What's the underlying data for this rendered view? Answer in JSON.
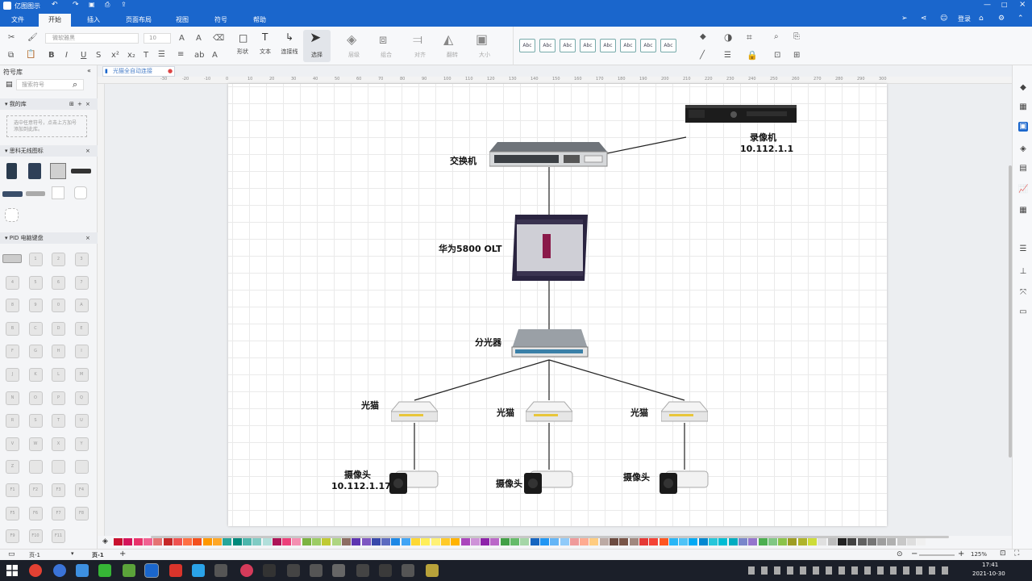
{
  "app": {
    "title": "亿图图示"
  },
  "titlebar": {
    "login": "登录"
  },
  "menu": {
    "tabs": [
      "文件",
      "开始",
      "插入",
      "页面布局",
      "视图",
      "符号",
      "帮助"
    ],
    "active_index": 1
  },
  "ribbon": {
    "font_name": "微软雅黑",
    "font_size": "10",
    "tools": [
      {
        "label": "形状",
        "icon": "□"
      },
      {
        "label": "文本",
        "icon": "T"
      },
      {
        "label": "连接线",
        "icon": "↳"
      },
      {
        "label": "选择",
        "icon": "➤"
      }
    ],
    "arrange": [
      "层级",
      "组合",
      "对齐",
      "翻转",
      "大小"
    ],
    "style_samples": [
      "Abc",
      "Abc",
      "Abc",
      "Abc",
      "Abc",
      "Abc",
      "Abc",
      "Abc"
    ]
  },
  "library": {
    "title": "符号库",
    "search_placeholder": "搜索符号",
    "my_library": {
      "title": "我的库",
      "hint": "选中任意符号，点击上方加号添加到此库。"
    },
    "sections": [
      "思科无线图标",
      "PID 电脑键盘"
    ],
    "keys": [
      "1",
      "2",
      "3",
      "4",
      "5",
      "6",
      "7",
      "8",
      "9",
      "0",
      "A",
      "B",
      "C",
      "D",
      "E",
      "F",
      "G",
      "H",
      "I",
      "J",
      "K",
      "L",
      "M",
      "N",
      "O",
      "P",
      "Q",
      "R",
      "S",
      "T",
      "U",
      "V",
      "W",
      "X",
      "Y",
      "Z",
      "",
      "",
      "",
      "F1",
      "F2",
      "F3",
      "F4",
      "F5",
      "F6",
      "F7",
      "F8",
      "F9",
      "F10",
      "F11"
    ]
  },
  "doc": {
    "tab_name": "光猫全自动连接"
  },
  "ruler": {
    "ticks": [
      "-30",
      "-20",
      "-10",
      "0",
      "10",
      "20",
      "30",
      "40",
      "50",
      "60",
      "70",
      "80",
      "90",
      "100",
      "110",
      "120",
      "130",
      "140",
      "150",
      "160",
      "170",
      "180",
      "190",
      "200",
      "210",
      "220",
      "230",
      "240",
      "250",
      "260",
      "270",
      "280",
      "290",
      "300"
    ]
  },
  "diagram": {
    "recorder_label": "录像机",
    "recorder_ip": "10.112.1.1",
    "switch_label": "交换机",
    "olt_label": "华为5800 OLT",
    "splitter_label": "分光器",
    "ont_labels": [
      "光猫",
      "光猫",
      "光猫"
    ],
    "camera_label_1": "摄像头",
    "camera_ip_1": "10.112.1.17",
    "camera_label_2": "摄像头",
    "camera_label_3": "摄像头"
  },
  "status": {
    "page_tab": "页-1",
    "page_current": "页-1",
    "zoom": "125%"
  },
  "taskbar": {
    "time": "17:41",
    "date": "2021-10-30"
  },
  "palette": [
    "#c8102e",
    "#d4145a",
    "#e8336b",
    "#f06292",
    "#e57373",
    "#c62828",
    "#ef5350",
    "#ff7043",
    "#f4511e",
    "#ff9800",
    "#ffa726",
    "#26a69a",
    "#00897b",
    "#4db6ac",
    "#80cbc4",
    "#b2dfdb",
    "#ad1457",
    "#ec407a",
    "#f48fb1",
    "#7cb342",
    "#9ccc65",
    "#c0ca33",
    "#aed581",
    "#8d6e63",
    "#5e35b1",
    "#7e57c2",
    "#3949ab",
    "#5c6bc0",
    "#1e88e5",
    "#42a5f5",
    "#fdd835",
    "#ffee58",
    "#fff176",
    "#ffca28",
    "#ffb300",
    "#ab47bc",
    "#ce93d8",
    "#8e24aa",
    "#ba68c8",
    "#43a047",
    "#66bb6a",
    "#a5d6a7",
    "#1565c0",
    "#2196f3",
    "#64b5f6",
    "#90caf9",
    "#ef9a9a",
    "#ffab91",
    "#ffcc80",
    "#bcaaa4",
    "#6d4c41",
    "#795548",
    "#a1887f",
    "#e53935",
    "#f44336",
    "#ff5722",
    "#29b6f6",
    "#4fc3f7",
    "#03a9f4",
    "#0288d1",
    "#26c6da",
    "#00bcd4",
    "#00acc1",
    "#7986cb",
    "#9575cd",
    "#4caf50",
    "#81c784",
    "#8bc34a",
    "#9e9d24",
    "#afb42b",
    "#cddc39",
    "#e0e0e0",
    "#bdbdbd",
    "#222222",
    "#424242",
    "#616161",
    "#757575",
    "#9e9e9e",
    "#b0b0b0",
    "#c8c8c8",
    "#dedede",
    "#f0f0f0"
  ]
}
